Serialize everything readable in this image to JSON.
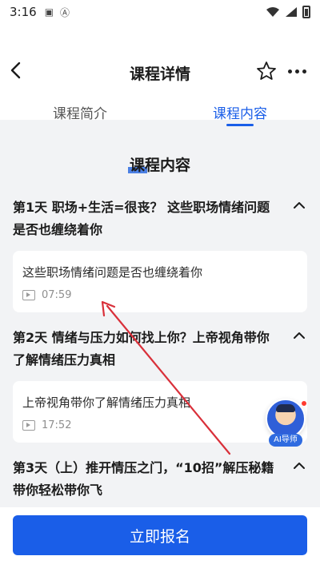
{
  "status_bar": {
    "time": "3:16"
  },
  "header": {
    "title": "课程详情"
  },
  "tabs": [
    {
      "label": "课程简介",
      "active": false
    },
    {
      "label": "课程内容",
      "active": true
    }
  ],
  "section_title": "课程内容",
  "days": [
    {
      "title": "第1天 职场+生活=很丧？ 这些职场情绪问题是否也缠绕着你",
      "lesson": {
        "title": "这些职场情绪问题是否也缠绕着你",
        "duration": "07:59"
      }
    },
    {
      "title": "第2天 情绪与压力如何找上你？上帝视角带你了解情绪压力真相",
      "lesson": {
        "title": "上帝视角带你了解情绪压力真相",
        "duration": "17:52"
      }
    },
    {
      "title": "第3天（上）推开情压之门，“10招”解压秘籍带你轻松带你飞"
    }
  ],
  "ai_assistant": {
    "label": "AI导师"
  },
  "cta": {
    "label": "立即报名"
  },
  "colors": {
    "accent": "#1a5ee8",
    "annotation_arrow": "#d9303a"
  }
}
